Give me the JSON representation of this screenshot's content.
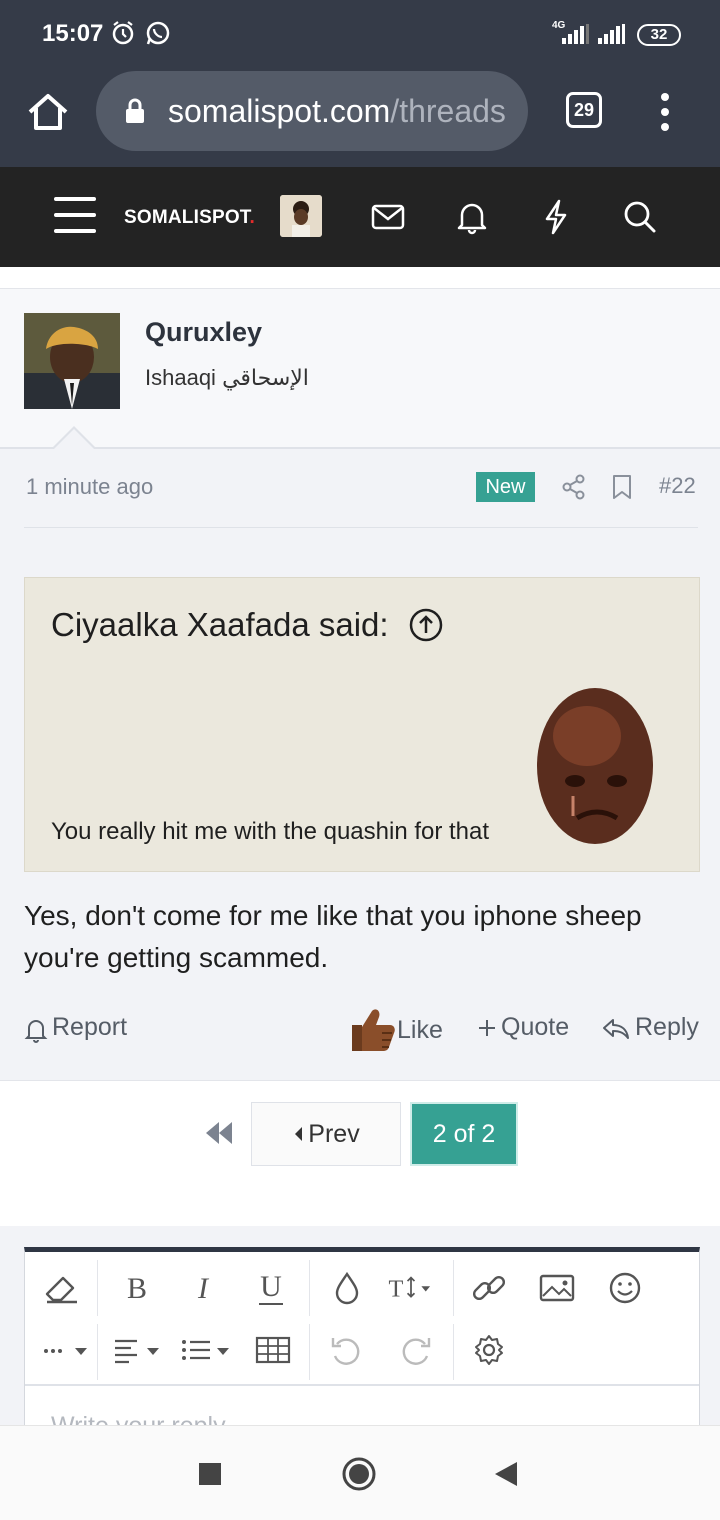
{
  "status_bar": {
    "time": "15:07",
    "network": "4G",
    "battery": "32"
  },
  "browser": {
    "url_domain": "somalispot.com",
    "url_path": "/threads",
    "tab_count": "29"
  },
  "site": {
    "logo_text": "SOMALISPOT",
    "logo_dot": "."
  },
  "post": {
    "username": "Quruxley",
    "user_title": "Ishaaqi الإسحاقي",
    "time": "1 minute ago",
    "badge": "New",
    "post_number": "#22",
    "quote_author": "Ciyaalka Xaafada said:",
    "quote_text": "You really hit me with the quashin for that",
    "body": "Yes, don't come for me like that you iphone sheep you're getting scammed.",
    "actions": {
      "report": "Report",
      "like": "Like",
      "quote": "Quote",
      "reply": "Reply"
    }
  },
  "pagination": {
    "prev": "Prev",
    "current": "2 of 2"
  },
  "editor": {
    "placeholder": "Write your reply..."
  },
  "colors": {
    "accent": "#36a193",
    "header": "#232323",
    "browser_bar": "#353b48",
    "quote_bg": "#ebe8dd"
  },
  "icons": [
    "alarm-icon",
    "whatsapp-icon",
    "signal-icon",
    "home-icon",
    "lock-icon",
    "kebab-menu-icon",
    "hamburger-icon",
    "envelope-icon",
    "bell-icon",
    "bolt-icon",
    "search-icon",
    "share-icon",
    "bookmark-icon",
    "arrow-up-circle-icon",
    "thumbs-up-icon",
    "plus-icon",
    "reply-icon",
    "first-page-icon",
    "eraser-icon",
    "bold-icon",
    "italic-icon",
    "underline-icon",
    "color-drop-icon",
    "font-size-icon",
    "link-icon",
    "image-icon",
    "smiley-icon",
    "more-icon",
    "align-icon",
    "list-icon",
    "table-icon",
    "undo-icon",
    "redo-icon",
    "gear-icon",
    "stop-icon",
    "home-circle-icon",
    "back-icon"
  ]
}
